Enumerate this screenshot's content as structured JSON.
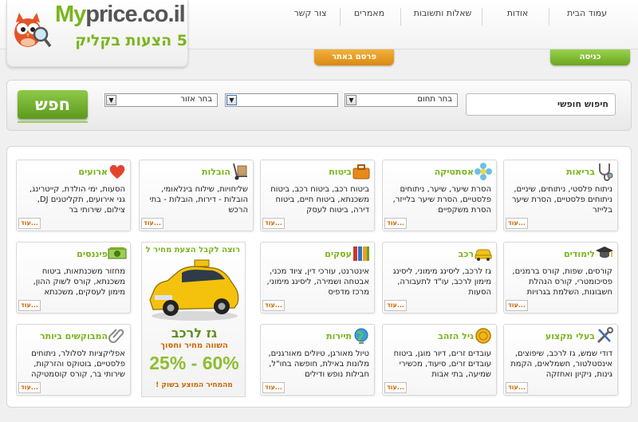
{
  "brand": {
    "logo_part1": "My",
    "logo_part2": "price.co.il",
    "tagline": "5 הצעות בקליק"
  },
  "nav": {
    "items": [
      {
        "label": "עמוד הבית"
      },
      {
        "label": "אודות"
      },
      {
        "label": "שאלות ותשובות"
      },
      {
        "label": "מאמרים"
      },
      {
        "label": "צור קשר"
      }
    ]
  },
  "tabs": {
    "login": "כניסה",
    "advertise": "פרסם באתר"
  },
  "search": {
    "free_search": "חיפוש חופשי",
    "field_select": "בחר תחום",
    "middle_select": "",
    "region_select": "בחר אזור",
    "button": "חפש"
  },
  "categories": [
    {
      "title": "בריאות",
      "icon": "stethoscope-icon",
      "desc": "ניתוח פלסטי, ניתוחים, שיניים, ניתוחים פלסטיים, הסרת שיער בלייזר",
      "more": "עוד..."
    },
    {
      "title": "אסתטיקה",
      "icon": "flower-icon",
      "desc": "הסרת שיער, שיער, ניתוחים פלסטיים, הסרת שיער בלייזר, הסרת משקפיים",
      "more": "עוד..."
    },
    {
      "title": "ביטוח",
      "icon": "briefcase-icon",
      "desc": "ביטוח רכב, ביטוח רכב, ביטוח משכנתא, ביטוח חיים, ביטוח דירה, ביטוח לעסק",
      "more": "עוד..."
    },
    {
      "title": "הובלות",
      "icon": "hand-truck-icon",
      "desc": "שליחויות, שילוח בינלאומי, הובלות - דירות, הובלות - בתי הרכש",
      "more": "עוד..."
    },
    {
      "title": "ארועים",
      "icon": "heart-icon",
      "desc": "הסעות, ימי הולדת, קייטרינג, גני אירועים, תקליטנים DJ, צילום, שירותי בר",
      "more": "עוד..."
    },
    {
      "title": "לימודים",
      "icon": "graduation-cap-icon",
      "desc": "קורסים, שפות, קורס ברמנים, פסיכומטרי, קורס הנהלת חשבונות, השלמת בגרויות",
      "more": "עוד..."
    },
    {
      "title": "רכב",
      "icon": "car-icon",
      "desc": "גז לרכב, ליסינג מימוני, ליסינג מימון לרכב, עו\"ד לתעבורה, הסעות",
      "more": "עוד..."
    },
    {
      "title": "עסקים",
      "icon": "binders-icon",
      "desc": "אינטרנט, עורכי דין, ציוד מכני, אבטחה ושמירה, ליסינג מימוני, מרכז מדפיס",
      "more": "עוד..."
    },
    {
      "title": "פיננסים",
      "icon": "money-icon",
      "desc": "מחזור משכנתאות, ביטוח משכנתא, קורס לשוק ההון, מימון לעסקים, משכנתא",
      "more": "עוד..."
    },
    {
      "title": "בעלי מקצוע",
      "icon": "tools-icon",
      "desc": "דודי שמש, גז לרכב, שיפוצים, אינסטלטור, חשמלאים, הקמת גינות, ניקיון ואחזקה",
      "more": "עוד..."
    },
    {
      "title": "גיל הזהב",
      "icon": "coin-icon",
      "desc": "עובדים זרים, דיור מוגן, ביטוח עובדים זרים, סיעוד, מכשירי שמיעה, בתי אבות",
      "more": "עוד..."
    },
    {
      "title": "תיירות",
      "icon": "globe-icon",
      "desc": "טיול מאורגן, טיולים מאורגנים, מלונות באילת, חופשה בחו\"ל, חבילות נופש ודילים",
      "more": "עוד..."
    },
    {
      "title": "המבוקשים ביותר",
      "icon": "paperclip-icon",
      "desc": "אפליקציות לסלולר, ניתוחים פלסטיים, בוטוקס והזרקות, שירותי בר, קורס קוסמטיקה",
      "more": "עוד..."
    }
  ],
  "promo": {
    "title": "רוצה לקבל הצעת מחיר ל",
    "product": "גז לרכב",
    "subtitle": "השווה מחיר וחסוך",
    "percent": "25% - 60%",
    "footer": "מהמחיר המוצע בשוק !"
  },
  "colors": {
    "brand_green": "#7ab51d",
    "tab_orange": "#e39a1c",
    "more_orange": "#cc6600"
  }
}
